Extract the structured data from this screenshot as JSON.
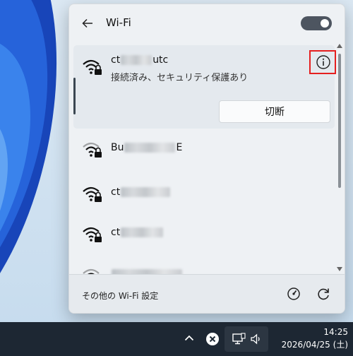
{
  "panel": {
    "title": "Wi-Fi",
    "wifi_enabled": true
  },
  "connected_network": {
    "ssid_prefix": "ct",
    "ssid_suffix": "utc",
    "status": "接続済み、セキュリティ保護あり",
    "disconnect_label": "切断",
    "icon": "wifi-secured-icon"
  },
  "networks": [
    {
      "ssid_prefix": "Bu",
      "ssid_suffix": "E",
      "icon": "wifi-secured-icon"
    },
    {
      "ssid_prefix": "ct",
      "ssid_suffix": "",
      "icon": "wifi-secured-icon"
    },
    {
      "ssid_prefix": "ct",
      "ssid_suffix": "",
      "icon": "wifi-secured-icon"
    },
    {
      "ssid_prefix": "",
      "ssid_suffix": "",
      "icon": "wifi-secured-icon"
    }
  ],
  "footer": {
    "more_settings": "その他の Wi-Fi 設定",
    "icons": [
      "network-settings-icon",
      "refresh-icon"
    ]
  },
  "taskbar": {
    "time": "14:25",
    "date": "2026/04/25 (土)",
    "icons": [
      "chevron-up-icon",
      "close-circle-icon",
      "network-icon",
      "volume-icon"
    ]
  },
  "colors": {
    "highlight": "#e51f1f",
    "taskbar": "#1d2733",
    "toggle_on": "#4d5560"
  }
}
